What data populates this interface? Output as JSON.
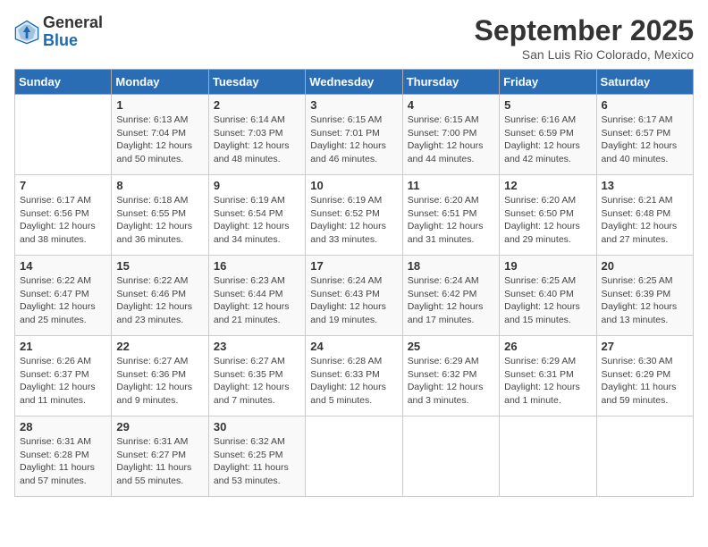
{
  "header": {
    "logo_general": "General",
    "logo_blue": "Blue",
    "month_title": "September 2025",
    "location": "San Luis Rio Colorado, Mexico"
  },
  "days_of_week": [
    "Sunday",
    "Monday",
    "Tuesday",
    "Wednesday",
    "Thursday",
    "Friday",
    "Saturday"
  ],
  "weeks": [
    [
      {
        "num": "",
        "info": ""
      },
      {
        "num": "1",
        "info": "Sunrise: 6:13 AM\nSunset: 7:04 PM\nDaylight: 12 hours\nand 50 minutes."
      },
      {
        "num": "2",
        "info": "Sunrise: 6:14 AM\nSunset: 7:03 PM\nDaylight: 12 hours\nand 48 minutes."
      },
      {
        "num": "3",
        "info": "Sunrise: 6:15 AM\nSunset: 7:01 PM\nDaylight: 12 hours\nand 46 minutes."
      },
      {
        "num": "4",
        "info": "Sunrise: 6:15 AM\nSunset: 7:00 PM\nDaylight: 12 hours\nand 44 minutes."
      },
      {
        "num": "5",
        "info": "Sunrise: 6:16 AM\nSunset: 6:59 PM\nDaylight: 12 hours\nand 42 minutes."
      },
      {
        "num": "6",
        "info": "Sunrise: 6:17 AM\nSunset: 6:57 PM\nDaylight: 12 hours\nand 40 minutes."
      }
    ],
    [
      {
        "num": "7",
        "info": "Sunrise: 6:17 AM\nSunset: 6:56 PM\nDaylight: 12 hours\nand 38 minutes."
      },
      {
        "num": "8",
        "info": "Sunrise: 6:18 AM\nSunset: 6:55 PM\nDaylight: 12 hours\nand 36 minutes."
      },
      {
        "num": "9",
        "info": "Sunrise: 6:19 AM\nSunset: 6:54 PM\nDaylight: 12 hours\nand 34 minutes."
      },
      {
        "num": "10",
        "info": "Sunrise: 6:19 AM\nSunset: 6:52 PM\nDaylight: 12 hours\nand 33 minutes."
      },
      {
        "num": "11",
        "info": "Sunrise: 6:20 AM\nSunset: 6:51 PM\nDaylight: 12 hours\nand 31 minutes."
      },
      {
        "num": "12",
        "info": "Sunrise: 6:20 AM\nSunset: 6:50 PM\nDaylight: 12 hours\nand 29 minutes."
      },
      {
        "num": "13",
        "info": "Sunrise: 6:21 AM\nSunset: 6:48 PM\nDaylight: 12 hours\nand 27 minutes."
      }
    ],
    [
      {
        "num": "14",
        "info": "Sunrise: 6:22 AM\nSunset: 6:47 PM\nDaylight: 12 hours\nand 25 minutes."
      },
      {
        "num": "15",
        "info": "Sunrise: 6:22 AM\nSunset: 6:46 PM\nDaylight: 12 hours\nand 23 minutes."
      },
      {
        "num": "16",
        "info": "Sunrise: 6:23 AM\nSunset: 6:44 PM\nDaylight: 12 hours\nand 21 minutes."
      },
      {
        "num": "17",
        "info": "Sunrise: 6:24 AM\nSunset: 6:43 PM\nDaylight: 12 hours\nand 19 minutes."
      },
      {
        "num": "18",
        "info": "Sunrise: 6:24 AM\nSunset: 6:42 PM\nDaylight: 12 hours\nand 17 minutes."
      },
      {
        "num": "19",
        "info": "Sunrise: 6:25 AM\nSunset: 6:40 PM\nDaylight: 12 hours\nand 15 minutes."
      },
      {
        "num": "20",
        "info": "Sunrise: 6:25 AM\nSunset: 6:39 PM\nDaylight: 12 hours\nand 13 minutes."
      }
    ],
    [
      {
        "num": "21",
        "info": "Sunrise: 6:26 AM\nSunset: 6:37 PM\nDaylight: 12 hours\nand 11 minutes."
      },
      {
        "num": "22",
        "info": "Sunrise: 6:27 AM\nSunset: 6:36 PM\nDaylight: 12 hours\nand 9 minutes."
      },
      {
        "num": "23",
        "info": "Sunrise: 6:27 AM\nSunset: 6:35 PM\nDaylight: 12 hours\nand 7 minutes."
      },
      {
        "num": "24",
        "info": "Sunrise: 6:28 AM\nSunset: 6:33 PM\nDaylight: 12 hours\nand 5 minutes."
      },
      {
        "num": "25",
        "info": "Sunrise: 6:29 AM\nSunset: 6:32 PM\nDaylight: 12 hours\nand 3 minutes."
      },
      {
        "num": "26",
        "info": "Sunrise: 6:29 AM\nSunset: 6:31 PM\nDaylight: 12 hours\nand 1 minute."
      },
      {
        "num": "27",
        "info": "Sunrise: 6:30 AM\nSunset: 6:29 PM\nDaylight: 11 hours\nand 59 minutes."
      }
    ],
    [
      {
        "num": "28",
        "info": "Sunrise: 6:31 AM\nSunset: 6:28 PM\nDaylight: 11 hours\nand 57 minutes."
      },
      {
        "num": "29",
        "info": "Sunrise: 6:31 AM\nSunset: 6:27 PM\nDaylight: 11 hours\nand 55 minutes."
      },
      {
        "num": "30",
        "info": "Sunrise: 6:32 AM\nSunset: 6:25 PM\nDaylight: 11 hours\nand 53 minutes."
      },
      {
        "num": "",
        "info": ""
      },
      {
        "num": "",
        "info": ""
      },
      {
        "num": "",
        "info": ""
      },
      {
        "num": "",
        "info": ""
      }
    ]
  ]
}
